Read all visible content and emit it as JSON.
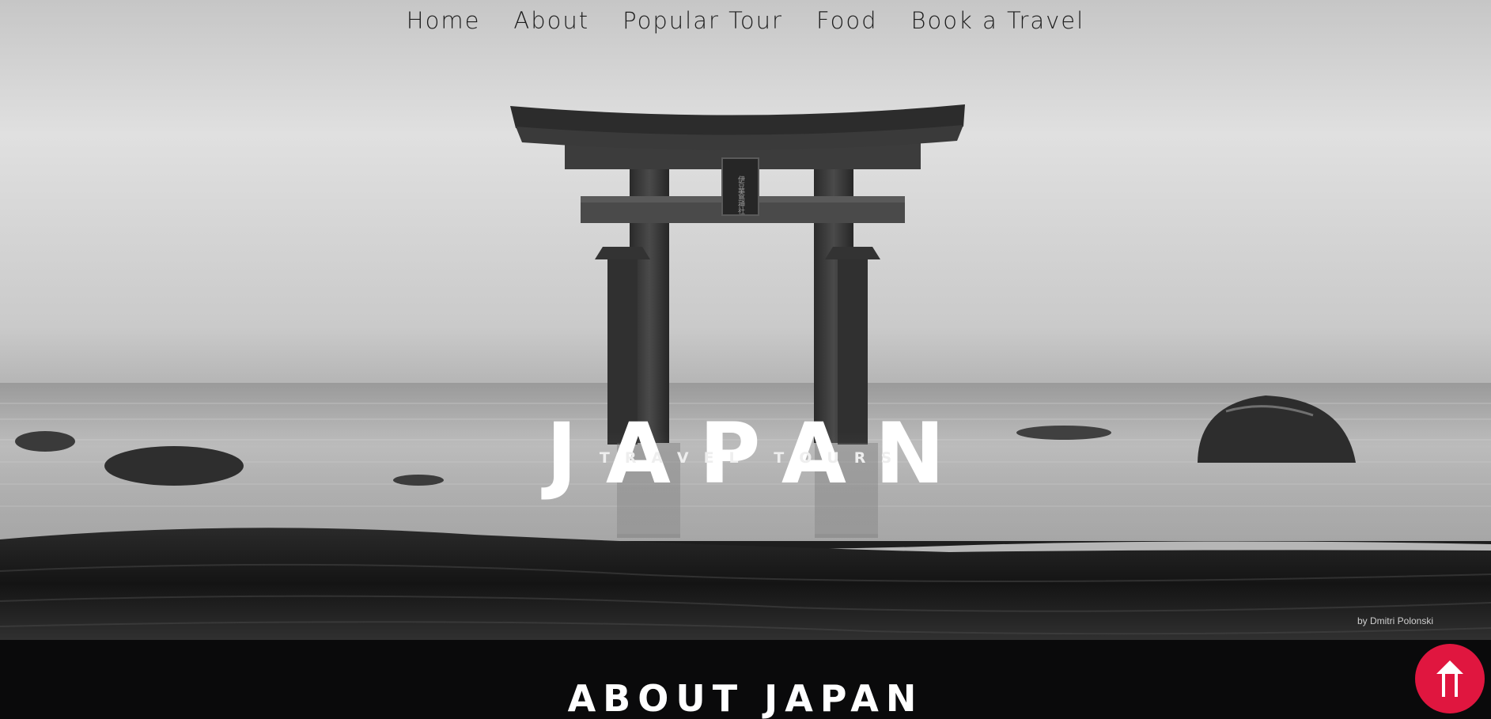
{
  "nav": {
    "items": [
      {
        "label": "Home"
      },
      {
        "label": "About"
      },
      {
        "label": "Popular Tour"
      },
      {
        "label": "Food"
      },
      {
        "label": "Book a Travel"
      }
    ]
  },
  "hero": {
    "title": "JAPAN",
    "subtitle": "TRAVEL TOURS",
    "photo_credit": "by Dmitri Polonski",
    "shrine_plaque_text": "伊豆美島神社"
  },
  "about": {
    "heading": "ABOUT JAPAN"
  },
  "scroll_top": {
    "icon": "double-arrow-up-icon",
    "color": "#e0163f"
  }
}
